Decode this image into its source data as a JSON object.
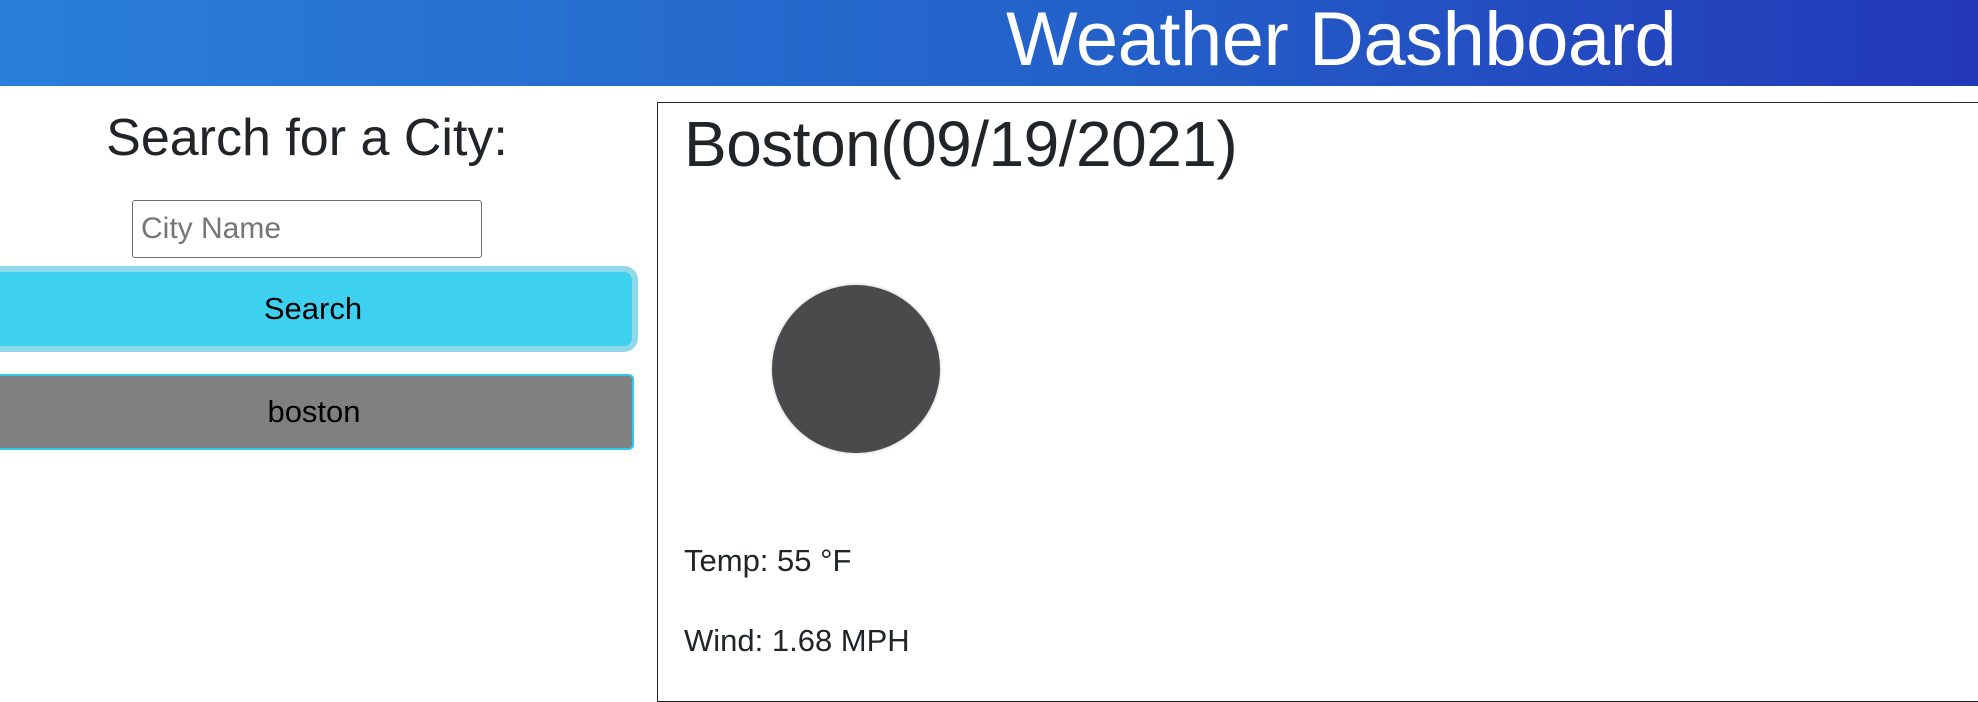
{
  "header": {
    "title": "Weather Dashboard"
  },
  "sidebar": {
    "heading": "Search for a City:",
    "search_input": {
      "value": "",
      "placeholder": "City Name"
    },
    "search_button_label": "Search",
    "history": [
      {
        "label": "boston"
      }
    ]
  },
  "current": {
    "title": "Boston(09/19/2021)",
    "icon": "weather-icon-dark-circle",
    "temp": "Temp: 55 °F",
    "wind": "Wind: 1.68 MPH"
  },
  "colors": {
    "header_gradient_start": "#2a7fd8",
    "header_gradient_end": "#2338b8",
    "search_button": "#3dd1ef",
    "history_button": "#808080",
    "history_border": "#33c6e6"
  }
}
